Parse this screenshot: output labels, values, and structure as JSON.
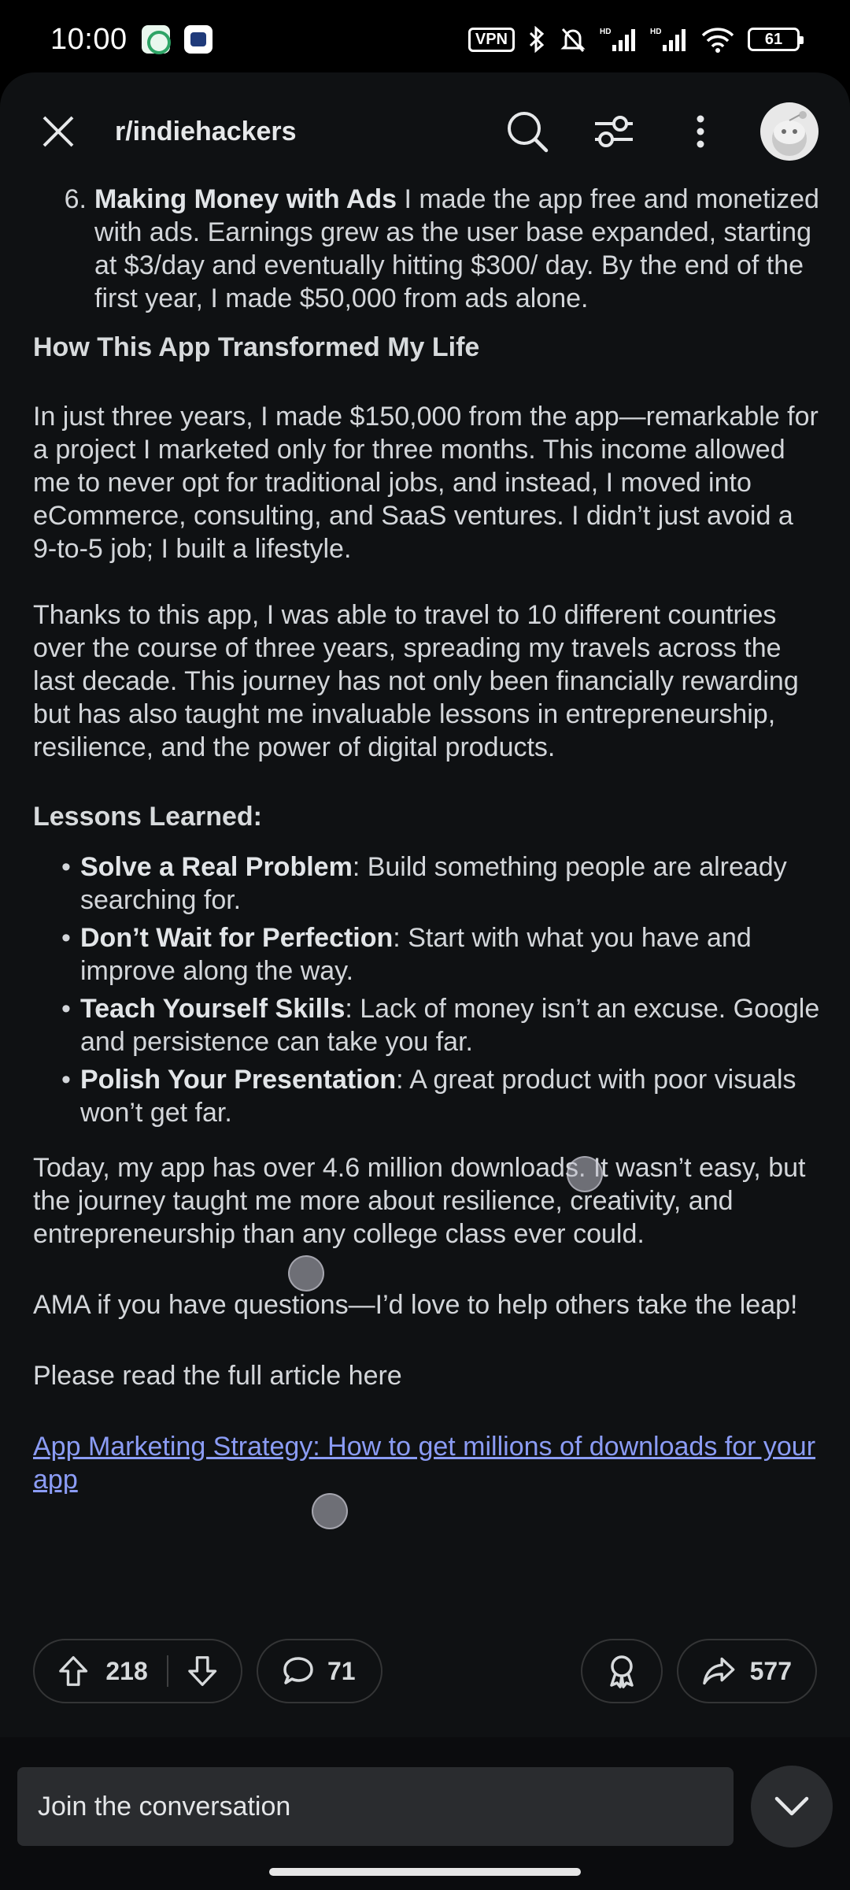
{
  "status_bar": {
    "time": "10:00",
    "vpn": "VPN",
    "battery": "61"
  },
  "header": {
    "subreddit": "r/indiehackers"
  },
  "post": {
    "item6": {
      "number": "6.",
      "bold": "Making Money with Ads",
      "text": " I made the app free and monetized with ads. Earnings grew as the user base expanded, starting at $3/day and eventually hitting $300/ day. By the end of the first year, I made $50,000 from ads alone."
    },
    "heading_transform": "How This App Transformed My Life",
    "para1": "In just three years, I made $150,000 from the app—remarkable for a project I marketed only for three months. This income allowed me to never opt for traditional jobs, and instead, I moved into eCommerce, consulting, and SaaS ventures. I didn’t just avoid a 9-to-5 job; I built a lifestyle.",
    "para2": "Thanks to this app, I was able to travel to 10 different countries over the course of three years, spreading my travels across the last decade. This journey has not only been financially rewarding but has also taught me invaluable lessons in entrepreneurship, resilience, and the power of digital products.",
    "heading_lessons": "Lessons Learned:",
    "lessons": [
      {
        "bold": "Solve a Real Problem",
        "text": ": Build something people are already searching for."
      },
      {
        "bold": "Don’t Wait for Perfection",
        "text": ": Start with what you have and improve along the way."
      },
      {
        "bold": "Teach Yourself Skills",
        "text": ": Lack of money isn’t an excuse. Google and persistence can take you far."
      },
      {
        "bold": "Polish Your Presentation",
        "text": ": A great product with poor visuals won’t get far."
      }
    ],
    "para3": "Today, my app has over 4.6 million downloads. It wasn’t easy, but the journey taught me more about resilience, creativity, and entrepreneurship than any college class ever could.",
    "para4": "AMA if you have questions—I’d love to help others take the leap!",
    "para5": "Please read the full article here",
    "link_text": "App Marketing Strategy: How to get millions of downloads for your app"
  },
  "actions": {
    "upvotes": "218",
    "comments": "71",
    "shares": "577"
  },
  "reply": {
    "placeholder": "Join the conversation"
  },
  "colors": {
    "background": "#0f1113",
    "link": "#8b9cf5",
    "text": "#d3d6da"
  }
}
